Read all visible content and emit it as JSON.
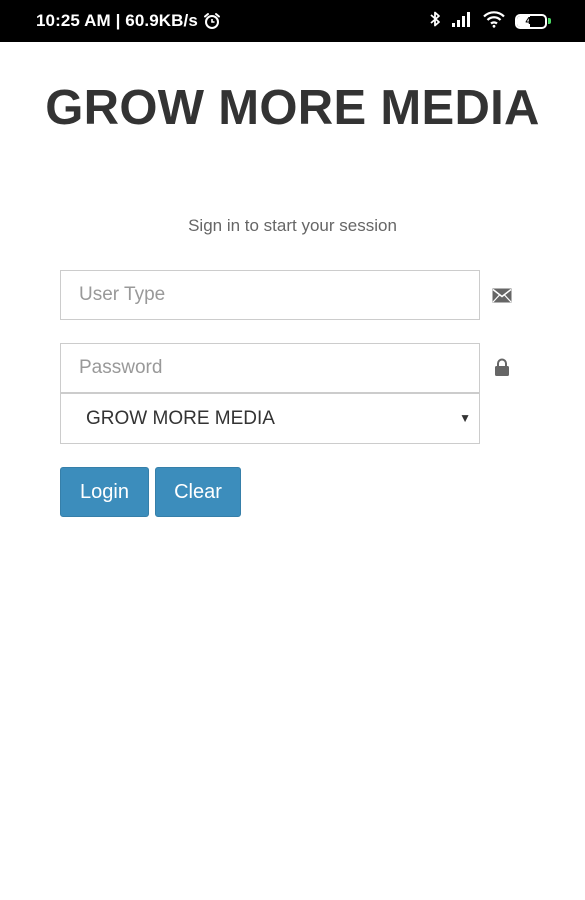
{
  "status_bar": {
    "time_speed": "10:25 AM | 60.9KB/s",
    "battery_level": "46",
    "battery_fraction": 0.46,
    "icons": [
      "alarm-icon",
      "bluetooth-icon",
      "signal-icon",
      "wifi-icon",
      "battery-icon"
    ]
  },
  "app": {
    "brand": "GROW MORE MEDIA",
    "subtitle": "Sign in to start your session"
  },
  "form": {
    "user_type": {
      "placeholder": "User Type",
      "value": "",
      "icon": "envelope-icon"
    },
    "password": {
      "placeholder": "Password",
      "value": "",
      "icon": "lock-icon"
    },
    "company_select": {
      "selected": "GROW MORE MEDIA"
    },
    "login_label": "Login",
    "clear_label": "Clear"
  },
  "colors": {
    "primary_button": "#3c8dbc",
    "brand_text": "#333333",
    "status_bar": "#000000",
    "battery_tip": "#4cd964"
  }
}
